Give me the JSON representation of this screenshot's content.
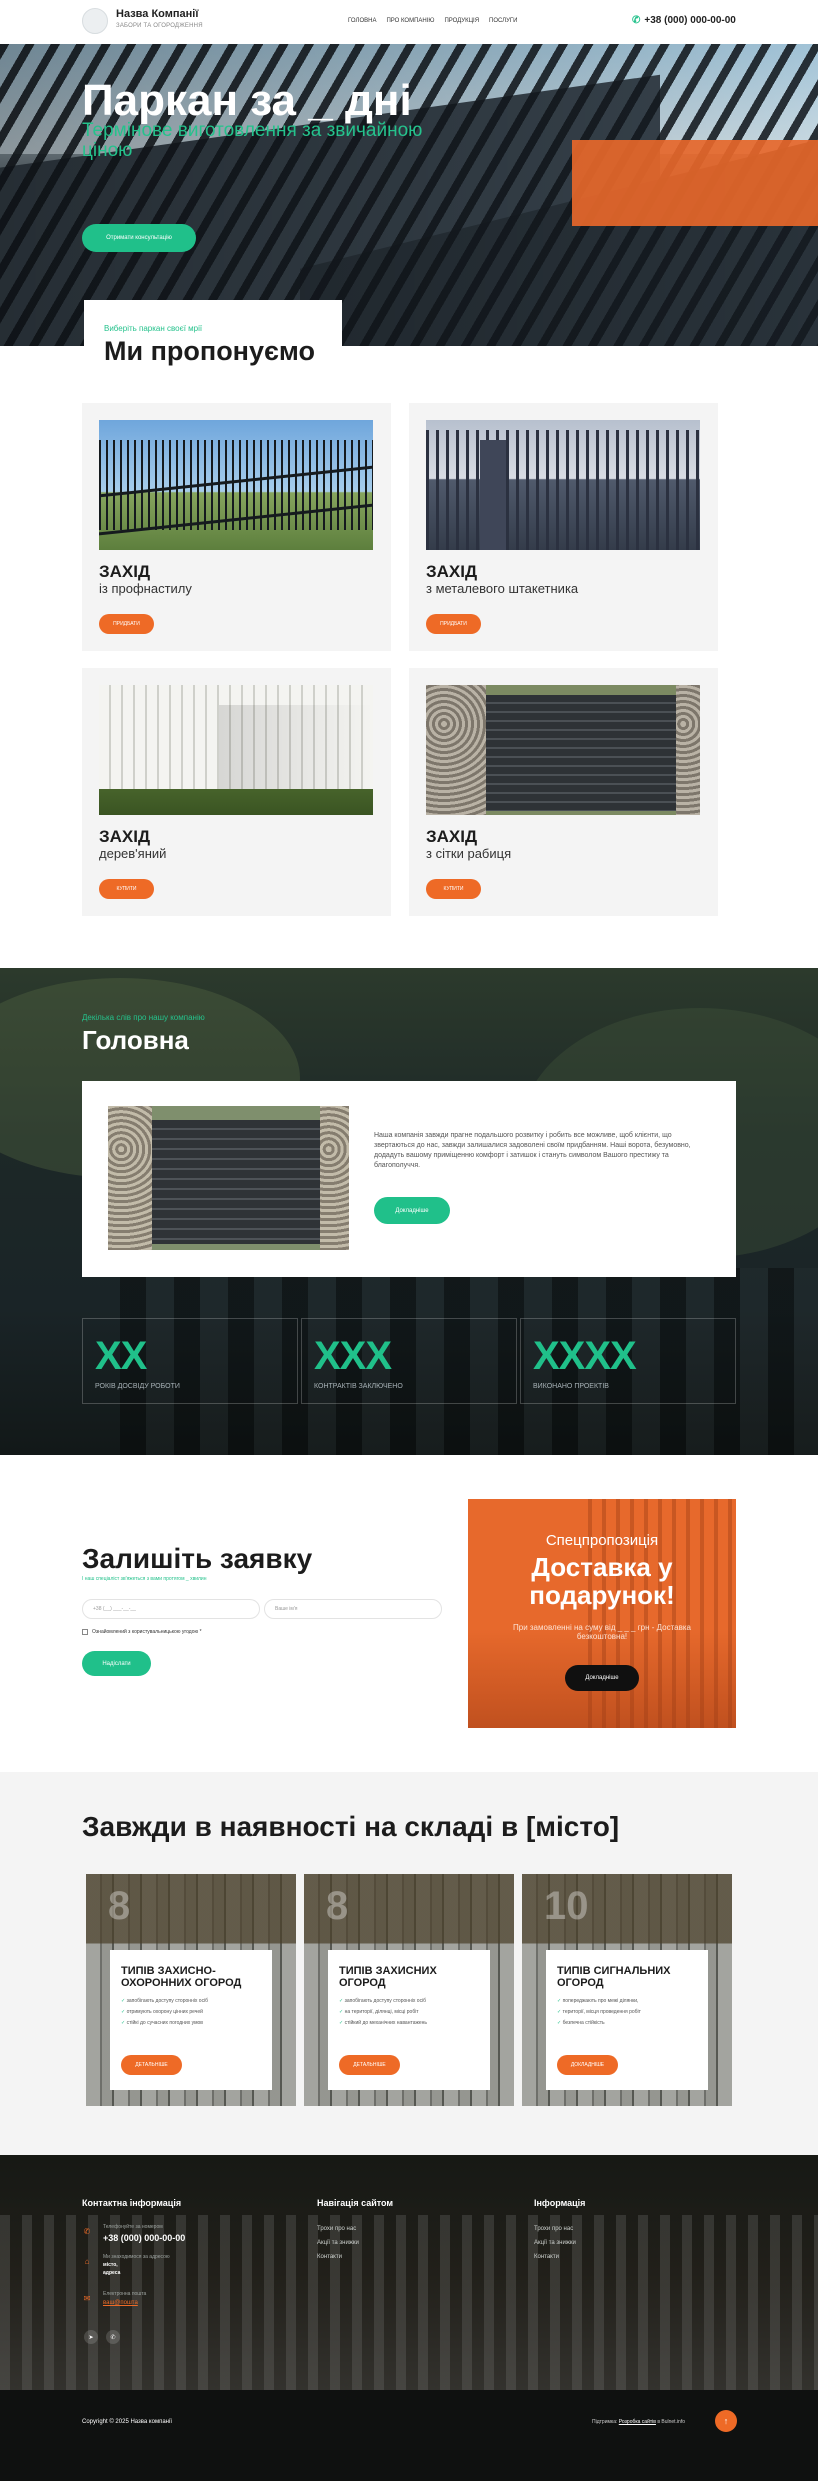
{
  "colors": {
    "accent_green": "#20c08a",
    "accent_orange": "#ee6a26",
    "dark": "#1c1c1c"
  },
  "header": {
    "company_name": "Назва Компанії",
    "company_sub": "ЗАБОРИ ТА ОГОРОДЖЕННЯ",
    "nav": [
      "ГОЛОВНА",
      "ПРО КОМПАНІЮ",
      "ПРОДУКЦІЯ",
      "ПОСЛУГИ"
    ],
    "phone": "+38 (000) 000-00-00",
    "phone_icon": "phone-icon"
  },
  "hero": {
    "title": "Паркан за _ дні",
    "subtitle": "Термінове виготовлення за звичайною ціною",
    "button": "Отримати консультацію"
  },
  "offer": {
    "kicker": "Виберіть паркан своєї мрії",
    "title": "Ми пропонуємо",
    "products": [
      {
        "title": "ЗАХІД",
        "subtitle": "із профнастилу",
        "button": "ПРИДБАТИ"
      },
      {
        "title": "ЗАХІД",
        "subtitle": "з металевого штакетника",
        "button": "ПРИДБАТИ"
      },
      {
        "title": "ЗАХІД",
        "subtitle": "дерев'яний",
        "button": "КУПИТИ"
      },
      {
        "title": "ЗАХІД",
        "subtitle": "з сітки рабиця",
        "button": "КУПИТИ"
      }
    ]
  },
  "about": {
    "kicker": "Декілька слів про нашу компанію",
    "title": "Головна",
    "text": "Наша компанія завжди прагне подальшого розвитку і робить все можливе, щоб клієнти, що звертаються до нас, завжди залишалися задоволені своїм придбанням. Наші ворота, безумовно, додадуть вашому приміщенню комфорт і затишок і стануть символом Вашого престижу та благополуччя.",
    "button": "Докладніше",
    "stats": [
      {
        "num": "XX",
        "label": "РОКІВ ДОСВІДУ РОБОТИ"
      },
      {
        "num": "XXX",
        "label": "КОНТРАКТІВ ЗАКЛЮЧЕНО"
      },
      {
        "num": "XXXX",
        "label": "ВИКОНАНО ПРОЕКТІВ"
      }
    ]
  },
  "lead": {
    "title": "Залишіть заявку",
    "subtitle": "І наш спеціаліст зв'яжеться з вами протягом _ хвилин",
    "phone_placeholder": "+38 (__) ___-__-__",
    "name_placeholder": "Ваше ім'я",
    "consent": "Ознайомлений з користувальницькою угодою *",
    "button": "Надіслати"
  },
  "promo": {
    "kicker": "Спецпропозиція",
    "title": "Доставка у подарунок!",
    "text": "При замовленні на суму від _ _ _ грн - Доставка безкоштовна!",
    "button": "Докладніше"
  },
  "stock": {
    "title": "Завжди в наявності на складі в [місто]",
    "cards": [
      {
        "num": "8",
        "title": "ТИПІВ ЗАХИСНО-ОХОРОННИХ ОГОРОД",
        "items": [
          "запобігають доступу сторонніх осіб",
          "отримують охорону цінних речей",
          "стійкі до сучасних погодних умов"
        ],
        "button": "ДЕТАЛЬНІШЕ"
      },
      {
        "num": "8",
        "title": "ТИПІВ ЗАХИСНИХ ОГОРОД",
        "items": [
          "запобігають доступу сторонніх осіб",
          "на території, ділянці, місці робіт",
          "стійкий до механічних навантажень"
        ],
        "button": "ДЕТАЛЬНІШЕ"
      },
      {
        "num": "10",
        "title": "ТИПІВ СИГНАЛЬНИХ ОГОРОД",
        "items": [
          "попереджають про межі ділянки,",
          "території, місця проведення робіт",
          "безпечна стійкість"
        ],
        "button": "ДОКЛАДНІШЕ"
      }
    ]
  },
  "footer": {
    "contact": {
      "title": "Контактна інформація",
      "phone_label": "Телефонуйте за номером",
      "phone": "+38 (000) 000-00-00",
      "address_label": "Ми знаходимося за адресою",
      "address_lines": [
        "місто,",
        "адреса"
      ],
      "email_label": "Електронна пошта",
      "email": "ваш@пошта"
    },
    "nav": {
      "title": "Навігація сайтом",
      "links": [
        "Трохи про нас",
        "Акції та знижки",
        "Контакти"
      ]
    },
    "info": {
      "title": "Інформація",
      "links": [
        "Трохи про нас",
        "Акції та знижки",
        "Контакти"
      ]
    },
    "copyright": "Copyright © 2025 Назва компанії",
    "dev_prefix": "Підтримка:",
    "dev_link": "Розробка сайтів",
    "dev_suffix": "в Bulnet.info"
  }
}
